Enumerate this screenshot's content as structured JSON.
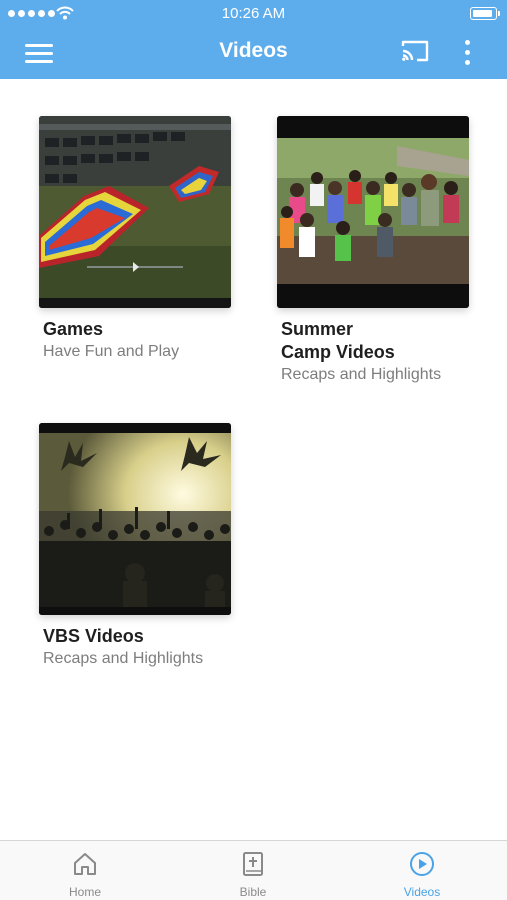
{
  "status_bar": {
    "time": "10:26 AM",
    "signal_icon": "signal-dots-icon",
    "wifi_icon": "wifi-icon",
    "battery_icon": "battery-icon"
  },
  "nav_bar": {
    "title": "Videos",
    "menu_icon": "hamburger-menu-icon",
    "cast_icon": "cast-icon",
    "more_icon": "more-vertical-icon",
    "background_color": "#5dadec"
  },
  "categories": [
    {
      "title": "Games",
      "subtitle": "Have Fun and Play"
    },
    {
      "title": "Summer\nCamp Videos",
      "subtitle": "Recaps and Highlights"
    },
    {
      "title": "VBS Videos",
      "subtitle": "Recaps and Highlights"
    }
  ],
  "tab_bar": {
    "tabs": [
      {
        "label": "Home",
        "icon": "home-icon",
        "active": false
      },
      {
        "label": "Bible",
        "icon": "bible-icon",
        "active": false
      },
      {
        "label": "Videos",
        "icon": "play-circle-icon",
        "active": true
      }
    ],
    "active_color": "#4aa3e6",
    "inactive_color": "#8a8a8a"
  }
}
